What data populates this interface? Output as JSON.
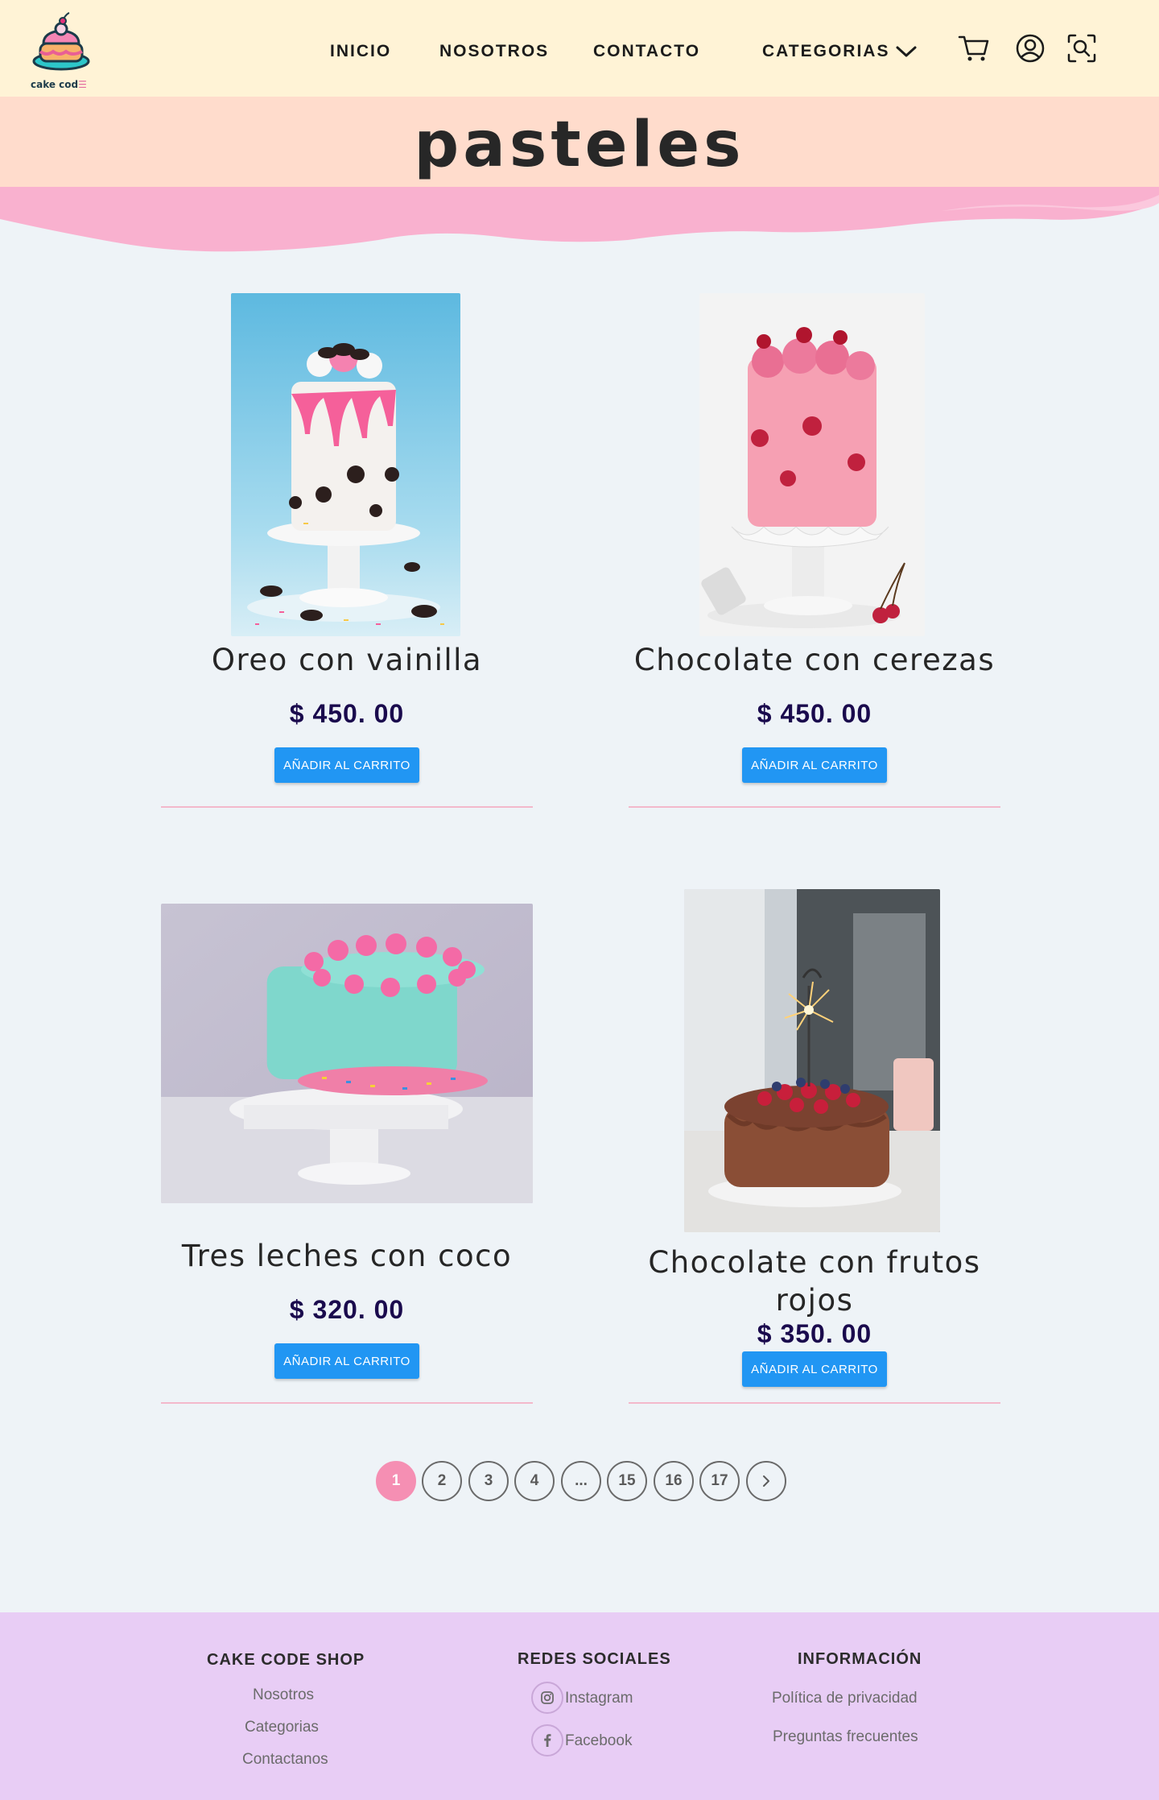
{
  "header": {
    "logo_text": "cake cod",
    "nav": {
      "inicio": "INICIO",
      "nosotros": "NOSOTROS",
      "contacto": "CONTACTO",
      "categorias": "CATEGORIAS"
    },
    "icons": [
      "cart-icon",
      "user-icon",
      "scan-search-icon",
      "chevron-down-icon"
    ]
  },
  "banner": {
    "title": "pasteles"
  },
  "products": [
    {
      "name": "Oreo con vainilla",
      "price": "$ 450. 00",
      "button": "AÑADIR AL CARRITO"
    },
    {
      "name": "Chocolate con cerezas",
      "price": "$ 450. 00",
      "button": "AÑADIR AL CARRITO"
    },
    {
      "name": "Tres leches con coco",
      "price": "$ 320. 00",
      "button": "AÑADIR AL CARRITO"
    },
    {
      "name": "Chocolate con frutos rojos",
      "price": "$ 350. 00",
      "button": "AÑADIR AL CARRITO"
    }
  ],
  "pagination": {
    "pages": [
      "1",
      "2",
      "3",
      "4",
      "...",
      "15",
      "16",
      "17"
    ],
    "current": "1",
    "next_icon": "chevron-right-icon"
  },
  "footer": {
    "shop": {
      "title": "CAKE CODE SHOP",
      "links": [
        "Nosotros",
        "Categorias",
        "Contactanos"
      ]
    },
    "social": {
      "title": "REDES SOCIALES",
      "links": [
        "Instagram",
        "Facebook"
      ]
    },
    "info": {
      "title": "INFORMACIÓN",
      "links": [
        "Política de privacidad",
        "Preguntas frecuentes"
      ]
    }
  },
  "colors": {
    "header_bg": "#fff3d6",
    "banner_bg": "#ffdccc",
    "wave_pink": "#f9b1cf",
    "page_bg": "#eef3f7",
    "button_blue": "#2196f3",
    "price_color": "#1a0a4d",
    "active_page": "#f58fb3",
    "footer_bg": "#e8cdf5"
  }
}
